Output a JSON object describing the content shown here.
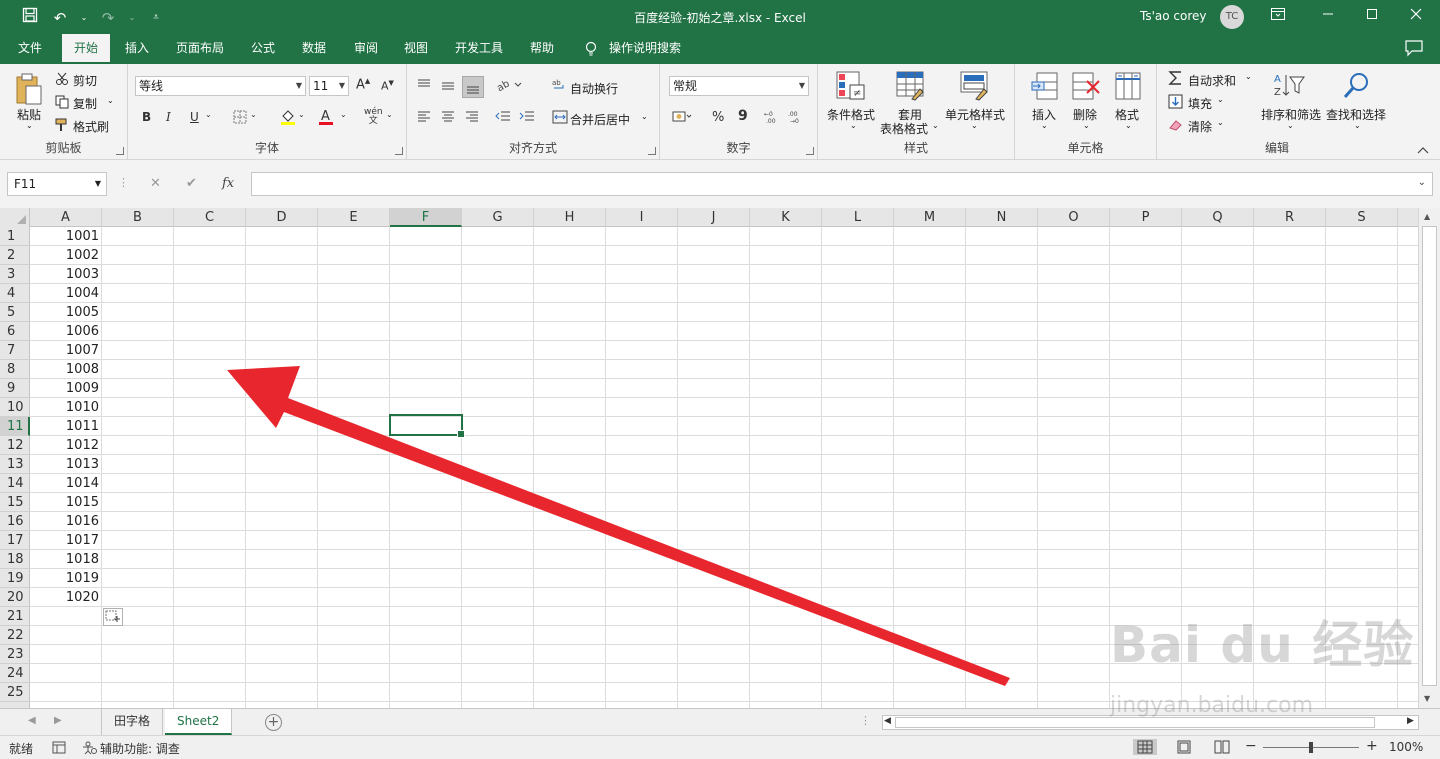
{
  "window": {
    "title": "百度经验-初始之章.xlsx  -  Excel",
    "user_name": "Ts'ao corey",
    "avatar_initials": "TC",
    "qat_icons": [
      "save-icon",
      "undo-icon",
      "redo-icon",
      "customize-icon"
    ],
    "accent": "#217346"
  },
  "menu": {
    "tabs": [
      "文件",
      "开始",
      "插入",
      "页面布局",
      "公式",
      "数据",
      "审阅",
      "视图",
      "开发工具",
      "帮助"
    ],
    "active_tab": "开始",
    "tell_me": "操作说明搜索"
  },
  "ribbon": {
    "clipboard": {
      "label": "剪贴板",
      "paste": "粘贴",
      "cut": "剪切",
      "copy": "复制",
      "format_painter": "格式刷"
    },
    "font": {
      "label": "字体",
      "font_name": "等线",
      "font_size": "11",
      "bold": "B",
      "italic": "I",
      "underline": "U",
      "phonetic": "wén"
    },
    "alignment": {
      "label": "对齐方式",
      "wrap_text": "自动换行",
      "merge_center": "合并后居中"
    },
    "number": {
      "label": "数字",
      "format": "常规",
      "percent": "%",
      "comma": "9"
    },
    "styles": {
      "label": "样式",
      "conditional": "条件格式",
      "table_line1": "套用",
      "table_line2": "表格格式",
      "cell_styles": "单元格样式"
    },
    "cells": {
      "label": "单元格",
      "insert": "插入",
      "delete": "删除",
      "format": "格式"
    },
    "editing": {
      "label": "编辑",
      "autosum": "自动求和",
      "fill": "填充",
      "clear": "清除",
      "sort_filter": "排序和筛选",
      "find_select": "查找和选择"
    }
  },
  "formula_bar": {
    "name_box": "F11",
    "cancel": "✕",
    "enter": "✔",
    "fx": "fx",
    "value": ""
  },
  "sheet": {
    "columns": [
      "A",
      "B",
      "C",
      "D",
      "E",
      "F",
      "G",
      "H",
      "I",
      "J",
      "K",
      "L",
      "M",
      "N",
      "O",
      "P",
      "Q",
      "R",
      "S"
    ],
    "selected_column": "F",
    "rows": [
      "1",
      "2",
      "3",
      "4",
      "5",
      "6",
      "7",
      "8",
      "9",
      "10",
      "11",
      "12",
      "13",
      "14",
      "15",
      "16",
      "17",
      "18",
      "19",
      "20",
      "21",
      "22",
      "23",
      "24",
      "25"
    ],
    "selected_row": "11",
    "column_a_values": [
      "1001",
      "1002",
      "1003",
      "1004",
      "1005",
      "1006",
      "1007",
      "1008",
      "1009",
      "1010",
      "1011",
      "1012",
      "1013",
      "1014",
      "1015",
      "1016",
      "1017",
      "1018",
      "1019",
      "1020"
    ],
    "selected_cell": "F11"
  },
  "annotation": {
    "arrow_color": "#e8262d"
  },
  "sheet_tabs": {
    "tabs": [
      "田字格",
      "Sheet2"
    ],
    "active": "Sheet2",
    "add": "+"
  },
  "status": {
    "ready": "就绪",
    "accessibility": "辅助功能: 调查",
    "zoom": "100%",
    "zoom_minus": "−",
    "zoom_plus": "+"
  },
  "watermark": {
    "brand": "Bai du 经验",
    "url": "jingyan.baidu.com"
  }
}
